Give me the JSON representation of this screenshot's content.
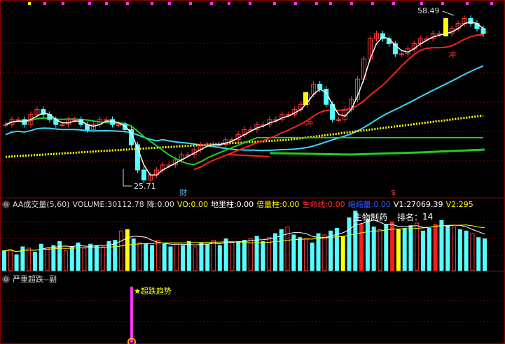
{
  "colors": {
    "background": "#000000",
    "grid": "#8b0000",
    "up": "#ff3b3b",
    "down": "#54ffff",
    "highlight": "#ffff00",
    "ma_white": "#ffffff",
    "ma_red": "#ff2020",
    "ma_cyan": "#33d8ff",
    "ma_yellow": "#ffff00",
    "ma_green": "#22cc22",
    "signal_pink": "#ff33ff"
  },
  "main_panel": {
    "high_label": "58.49",
    "low_label": "25.71",
    "marker_cai": "财",
    "marker_chong": "冲",
    "marker_dollar": "$"
  },
  "indicator_bar": {
    "button_icon": "⊙",
    "name": "AA成交量(5,60)",
    "volume_label": "VOLUME:",
    "volume_value": "30112.78",
    "jiang_label": "降:",
    "jiang_value": "0.00",
    "vo_label": "VO:",
    "vo_value": "0.00",
    "diliang_label": "地里柱:",
    "diliang_value": "0.00",
    "beiliang_label": "倍量柱:",
    "beiliang_value": "0.00",
    "shengming_label": "生命线:",
    "shengming_value": "0.00",
    "suoliang_label": "缩缩量:",
    "suoliang_value": "0.00",
    "v1_label": "V1:",
    "v1_value": "27069.39",
    "v2_label": "V2:",
    "v2_value": "295",
    "sector": "生物制药",
    "rank_label": "排名：",
    "rank_value": "14"
  },
  "bottom_panel": {
    "name": "严重超跌--副",
    "signal_label": "★超跌趋势"
  },
  "chart_data": [
    {
      "type": "candlestick",
      "title": "",
      "y_high": 58.49,
      "y_low": 25.71,
      "series": [
        {
          "name": "price_close",
          "values": [
            37,
            38,
            38,
            37,
            39,
            40,
            39,
            38,
            37,
            37,
            38,
            38,
            37,
            36,
            37,
            38,
            38,
            37,
            37,
            36,
            33,
            28,
            26,
            27,
            28,
            29,
            29,
            30,
            31,
            31,
            32,
            33,
            33,
            33,
            33,
            34,
            34,
            35,
            36,
            36,
            37,
            37,
            38,
            38,
            39,
            39,
            40,
            41,
            43,
            45,
            44,
            41,
            38,
            38,
            40,
            42,
            46,
            50,
            54,
            55,
            54,
            53,
            51,
            51,
            52,
            53,
            54,
            54,
            55,
            55,
            55,
            56,
            57,
            58,
            57,
            56,
            55
          ]
        }
      ]
    },
    {
      "type": "bar",
      "title": "AA成交量(5,60)",
      "series": [
        {
          "name": "VOLUME",
          "values": [
            30,
            32,
            24,
            36,
            34,
            28,
            40,
            34,
            38,
            44,
            30,
            36,
            42,
            34,
            40,
            38,
            36,
            44,
            46,
            60,
            62,
            48,
            42,
            40,
            38,
            46,
            40,
            36,
            40,
            38,
            44,
            36,
            42,
            40,
            46,
            38,
            48,
            42,
            44,
            46,
            48,
            52,
            44,
            50,
            56,
            62,
            66,
            54,
            50,
            48,
            42,
            56,
            54,
            60,
            64,
            52,
            80,
            90,
            70,
            78,
            66,
            62,
            70,
            74,
            62,
            64,
            68,
            72,
            60,
            64,
            70,
            76,
            68,
            66,
            62,
            60,
            56,
            50,
            48
          ]
        }
      ]
    }
  ]
}
